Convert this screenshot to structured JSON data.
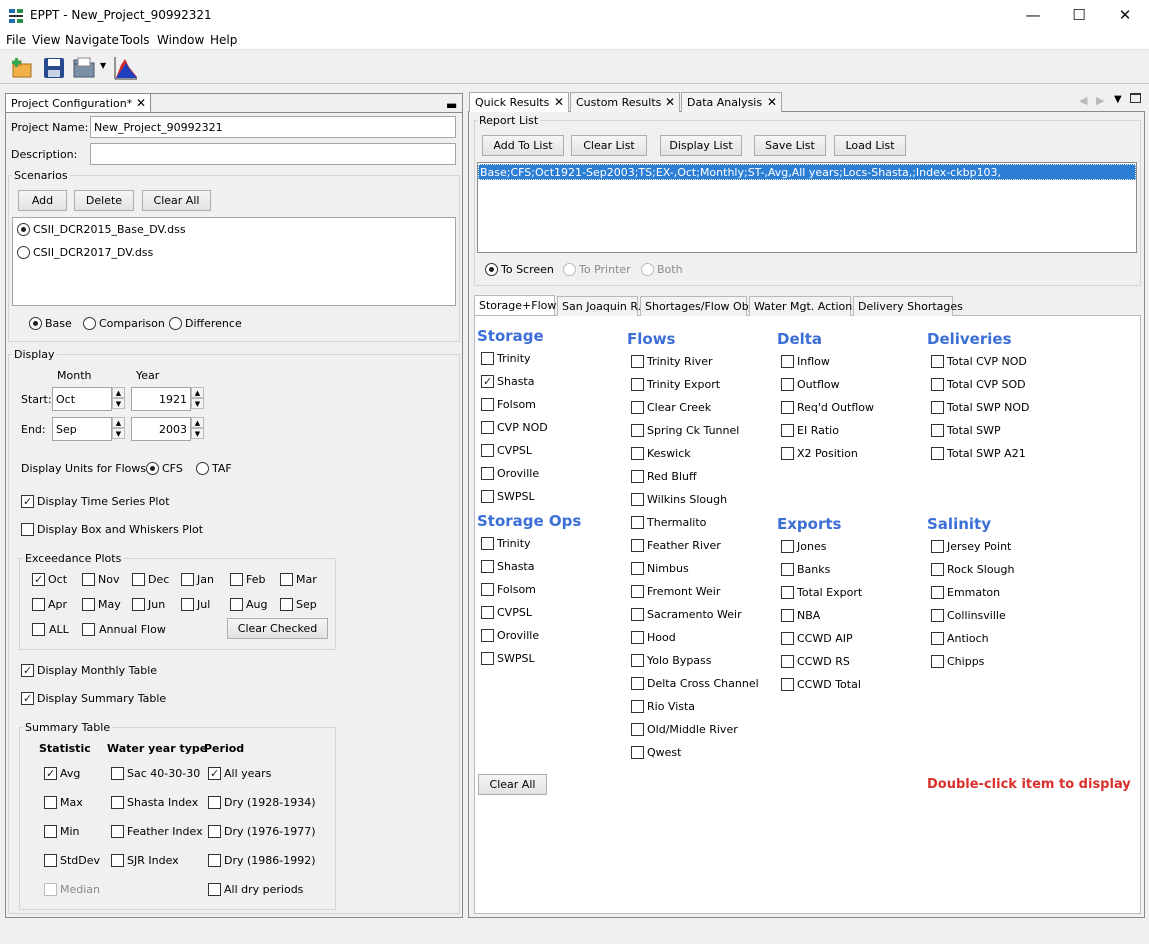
{
  "window": {
    "title": "EPPT - New_Project_90992321",
    "minimize": "—",
    "maximize": "☐",
    "close": "✕"
  },
  "menu": [
    "File",
    "View",
    "Navigate",
    "Tools",
    "Window",
    "Help"
  ],
  "toolbar_icons": [
    "new-project-icon",
    "save-icon",
    "open-folder-icon",
    "dropdown-arrow-icon",
    "chart-icon"
  ],
  "left_tab": {
    "label": "Project Configuration*"
  },
  "project": {
    "name_label": "Project Name:",
    "name_value": "New_Project_90992321",
    "desc_label": "Description:",
    "desc_value": ""
  },
  "scenarios": {
    "label": "Scenarios",
    "add": "Add",
    "delete": "Delete",
    "clear_all": "Clear All",
    "items": [
      {
        "label": "CSII_DCR2015_Base_DV.dss",
        "selected": true
      },
      {
        "label": "CSII_DCR2017_DV.dss",
        "selected": false
      }
    ],
    "modes": [
      {
        "label": "Base",
        "selected": true
      },
      {
        "label": "Comparison",
        "selected": false
      },
      {
        "label": "Difference",
        "selected": false
      }
    ]
  },
  "display": {
    "label": "Display",
    "month_header": "Month",
    "year_header": "Year",
    "start_label": "Start:",
    "start_month": "Oct",
    "start_year": "1921",
    "end_label": "End:",
    "end_month": "Sep",
    "end_year": "2003",
    "units_label": "Display Units for Flows:",
    "units": [
      {
        "label": "CFS",
        "selected": true
      },
      {
        "label": "TAF",
        "selected": false
      }
    ],
    "time_series": {
      "label": "Display Time Series Plot",
      "checked": true
    },
    "box_whiskers": {
      "label": "Display Box and Whiskers Plot",
      "checked": false
    },
    "exceedance": {
      "label": "Exceedance Plots",
      "months": [
        {
          "label": "Oct",
          "checked": true
        },
        {
          "label": "Nov",
          "checked": false
        },
        {
          "label": "Dec",
          "checked": false
        },
        {
          "label": "Jan",
          "checked": false
        },
        {
          "label": "Feb",
          "checked": false
        },
        {
          "label": "Mar",
          "checked": false
        },
        {
          "label": "Apr",
          "checked": false
        },
        {
          "label": "May",
          "checked": false
        },
        {
          "label": "Jun",
          "checked": false
        },
        {
          "label": "Jul",
          "checked": false
        },
        {
          "label": "Aug",
          "checked": false
        },
        {
          "label": "Sep",
          "checked": false
        }
      ],
      "all": {
        "label": "ALL",
        "checked": false
      },
      "annual": {
        "label": "Annual Flow",
        "checked": false
      },
      "clear_checked": "Clear Checked"
    },
    "monthly_table": {
      "label": "Display Monthly Table",
      "checked": true
    },
    "summary_table_cb": {
      "label": "Display Summary Table",
      "checked": true
    },
    "summary": {
      "label": "Summary Table",
      "statistic_header": "Statistic",
      "wy_header": "Water year type",
      "period_header": "Period",
      "statistics": [
        {
          "label": "Avg",
          "checked": true
        },
        {
          "label": "Max",
          "checked": false
        },
        {
          "label": "Min",
          "checked": false
        },
        {
          "label": "StdDev",
          "checked": false
        },
        {
          "label": "Median",
          "checked": false,
          "disabled": true
        }
      ],
      "wy_types": [
        {
          "label": "Sac 40-30-30",
          "checked": false
        },
        {
          "label": "Shasta Index",
          "checked": false
        },
        {
          "label": "Feather Index",
          "checked": false
        },
        {
          "label": "SJR Index",
          "checked": false
        }
      ],
      "periods": [
        {
          "label": "All years",
          "checked": true
        },
        {
          "label": "Dry (1928-1934)",
          "checked": false
        },
        {
          "label": "Dry (1976-1977)",
          "checked": false
        },
        {
          "label": "Dry (1986-1992)",
          "checked": false
        },
        {
          "label": "All dry periods",
          "checked": false
        }
      ]
    }
  },
  "right_tabs": [
    "Quick Results",
    "Custom Results",
    "Data Analysis"
  ],
  "report": {
    "label": "Report List",
    "buttons": [
      "Add To List",
      "Clear List",
      "Display List",
      "Save List",
      "Load List"
    ],
    "items": [
      "Base;CFS;Oct1921-Sep2003;TS;EX-,Oct;Monthly;ST-,Avg,All years;Locs-Shasta,;Index-ckbp103,"
    ],
    "outputs": [
      {
        "label": "To Screen",
        "selected": true,
        "disabled": false
      },
      {
        "label": "To Printer",
        "selected": false,
        "disabled": true
      },
      {
        "label": "Both",
        "selected": false,
        "disabled": true
      }
    ]
  },
  "sub_tabs": [
    "Storage+Flows",
    "San Joaquin R.",
    "Shortages/Flow Obj.",
    "Water Mgt. Actions",
    "Delivery Shortages"
  ],
  "columns": {
    "storage": {
      "title": "Storage",
      "items": [
        {
          "label": "Trinity",
          "checked": false
        },
        {
          "label": "Shasta",
          "checked": true
        },
        {
          "label": "Folsom",
          "checked": false
        },
        {
          "label": "CVP NOD",
          "checked": false
        },
        {
          "label": "CVPSL",
          "checked": false
        },
        {
          "label": "Oroville",
          "checked": false
        },
        {
          "label": "SWPSL",
          "checked": false
        }
      ]
    },
    "storage_ops": {
      "title": "Storage Ops",
      "items": [
        {
          "label": "Trinity",
          "checked": false
        },
        {
          "label": "Shasta",
          "checked": false
        },
        {
          "label": "Folsom",
          "checked": false
        },
        {
          "label": "CVPSL",
          "checked": false
        },
        {
          "label": "Oroville",
          "checked": false
        },
        {
          "label": "SWPSL",
          "checked": false
        }
      ]
    },
    "flows": {
      "title": "Flows",
      "items": [
        {
          "label": "Trinity River",
          "checked": false
        },
        {
          "label": "Trinity Export",
          "checked": false
        },
        {
          "label": "Clear Creek",
          "checked": false
        },
        {
          "label": "Spring Ck Tunnel",
          "checked": false
        },
        {
          "label": "Keswick",
          "checked": false
        },
        {
          "label": "Red Bluff",
          "checked": false
        },
        {
          "label": "Wilkins Slough",
          "checked": false
        },
        {
          "label": "Thermalito",
          "checked": false
        },
        {
          "label": "Feather River",
          "checked": false
        },
        {
          "label": "Nimbus",
          "checked": false
        },
        {
          "label": "Fremont Weir",
          "checked": false
        },
        {
          "label": "Sacramento Weir",
          "checked": false
        },
        {
          "label": "Hood",
          "checked": false
        },
        {
          "label": "Yolo Bypass",
          "checked": false
        },
        {
          "label": "Delta Cross Channel",
          "checked": false
        },
        {
          "label": "Rio Vista",
          "checked": false
        },
        {
          "label": "Old/Middle River",
          "checked": false
        },
        {
          "label": "Qwest",
          "checked": false
        }
      ]
    },
    "delta": {
      "title": "Delta",
      "items": [
        {
          "label": "Inflow",
          "checked": false
        },
        {
          "label": "Outflow",
          "checked": false
        },
        {
          "label": "Req'd Outflow",
          "checked": false
        },
        {
          "label": "EI Ratio",
          "checked": false
        },
        {
          "label": "X2 Position",
          "checked": false
        }
      ]
    },
    "exports": {
      "title": "Exports",
      "items": [
        {
          "label": "Jones",
          "checked": false
        },
        {
          "label": "Banks",
          "checked": false
        },
        {
          "label": "Total Export",
          "checked": false
        },
        {
          "label": "NBA",
          "checked": false
        },
        {
          "label": "CCWD AIP",
          "checked": false
        },
        {
          "label": "CCWD RS",
          "checked": false
        },
        {
          "label": "CCWD Total",
          "checked": false
        }
      ]
    },
    "deliveries": {
      "title": "Deliveries",
      "items": [
        {
          "label": "Total CVP NOD",
          "checked": false
        },
        {
          "label": "Total CVP SOD",
          "checked": false
        },
        {
          "label": "Total SWP NOD",
          "checked": false
        },
        {
          "label": "Total SWP",
          "checked": false
        },
        {
          "label": "Total SWP A21",
          "checked": false
        }
      ]
    },
    "salinity": {
      "title": "Salinity",
      "items": [
        {
          "label": "Jersey Point",
          "checked": false
        },
        {
          "label": "Rock Slough",
          "checked": false
        },
        {
          "label": "Emmaton",
          "checked": false
        },
        {
          "label": "Collinsville",
          "checked": false
        },
        {
          "label": "Antioch",
          "checked": false
        },
        {
          "label": "Chipps",
          "checked": false
        }
      ]
    }
  },
  "clear_all": "Clear All",
  "hint": {
    "text": "Double-click item to display",
    "color": "#d9302c"
  },
  "accent_color": "#3b6fd6"
}
